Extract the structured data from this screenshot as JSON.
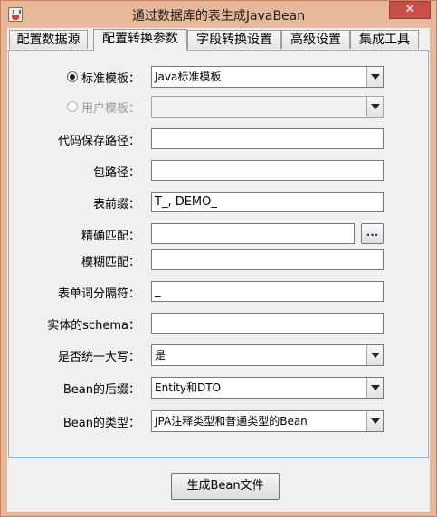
{
  "window": {
    "title": "通过数据库的表生成JavaBean",
    "close_glyph": "✕"
  },
  "tabs": [
    {
      "label": "配置数据源",
      "selected": false
    },
    {
      "label": "配置转换参数",
      "selected": true
    },
    {
      "label": "字段转换设置",
      "selected": false
    },
    {
      "label": "高级设置",
      "selected": false
    },
    {
      "label": "集成工具",
      "selected": false
    }
  ],
  "form": {
    "standard_template": {
      "label": "标准模板：",
      "checked": true,
      "value": "Java标准模板"
    },
    "user_template": {
      "label": "用户模板：",
      "checked": false,
      "enabled": false,
      "value": ""
    },
    "save_path": {
      "label": "代码保存路径：",
      "value": ""
    },
    "package_path": {
      "label": "包路径：",
      "value": ""
    },
    "table_prefix": {
      "label": "表前缀：",
      "value": "T_, DEMO_"
    },
    "exact_match": {
      "label": "精确匹配：",
      "value": "",
      "browse_label": "..."
    },
    "fuzzy_match": {
      "label": "模糊匹配：",
      "value": ""
    },
    "word_separator": {
      "label": "表单词分隔符：",
      "value": "_"
    },
    "entity_schema": {
      "label": "实体的schema：",
      "value": ""
    },
    "uppercase": {
      "label": "是否统一大写：",
      "value": "是"
    },
    "bean_suffix": {
      "label": "Bean的后缀：",
      "value": "Entity和DTO"
    },
    "bean_type": {
      "label": "Bean的类型：",
      "value": "JPA注释类型和普通类型的Bean"
    }
  },
  "actions": {
    "generate_label": "生成Bean文件"
  }
}
